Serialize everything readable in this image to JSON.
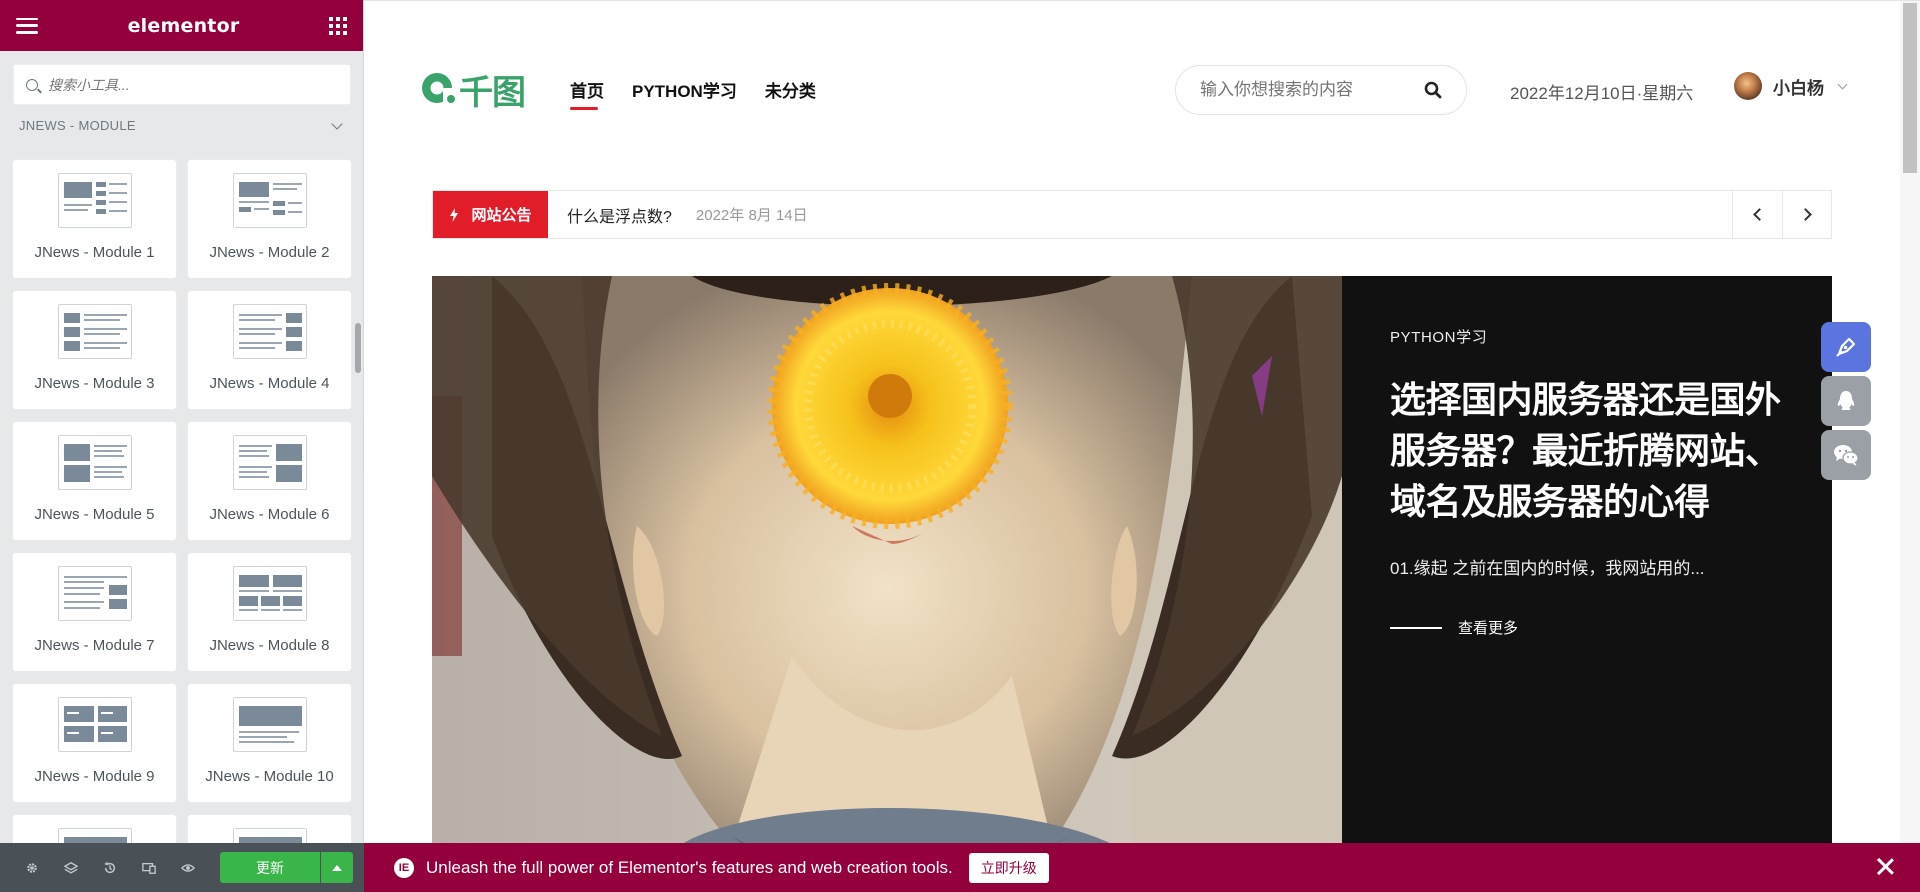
{
  "editor": {
    "brand": "elementor",
    "search_placeholder": "搜索小工具...",
    "category": "JNEWS - MODULE",
    "widgets": [
      {
        "label": "JNews - Module 1"
      },
      {
        "label": "JNews - Module 2"
      },
      {
        "label": "JNews - Module 3"
      },
      {
        "label": "JNews - Module 4"
      },
      {
        "label": "JNews - Module 5"
      },
      {
        "label": "JNews - Module 6"
      },
      {
        "label": "JNews - Module 7"
      },
      {
        "label": "JNews - Module 8"
      },
      {
        "label": "JNews - Module 9"
      },
      {
        "label": "JNews - Module 10"
      }
    ],
    "footer": {
      "icons": [
        "gear-icon",
        "layers-icon",
        "history-icon",
        "responsive-icon",
        "eye-icon"
      ],
      "update_label": "更新"
    },
    "accent": "#93003c",
    "update_color": "#39b54a"
  },
  "site": {
    "logo_text": "千图",
    "nav": [
      {
        "label": "首页",
        "active": true
      },
      {
        "label": "PYTHON学习",
        "active": false
      },
      {
        "label": "未分类",
        "active": false
      }
    ],
    "search_placeholder": "输入你想搜索的内容",
    "date": "2022年12月10日·星期六",
    "user": "小白杨",
    "ticker": {
      "badge": "网站公告",
      "title": "什么是浮点数?",
      "date": "2022年 8月 14日"
    },
    "hero": {
      "category": "PYTHON学习",
      "title": "选择国内服务器还是国外服务器？最近折腾网站、域名及服务器的心得",
      "excerpt": "01.缘起 之前在国内的时候，我网站用的...",
      "more": "查看更多"
    },
    "float_buttons": [
      "pen-icon",
      "qq-icon",
      "wechat-icon"
    ],
    "accent": "#e11d2a",
    "brand_green": "#3aa36b"
  },
  "promo": {
    "message": "Unleash the full power of Elementor's features and web creation tools.",
    "upgrade_label": "立即升级"
  }
}
